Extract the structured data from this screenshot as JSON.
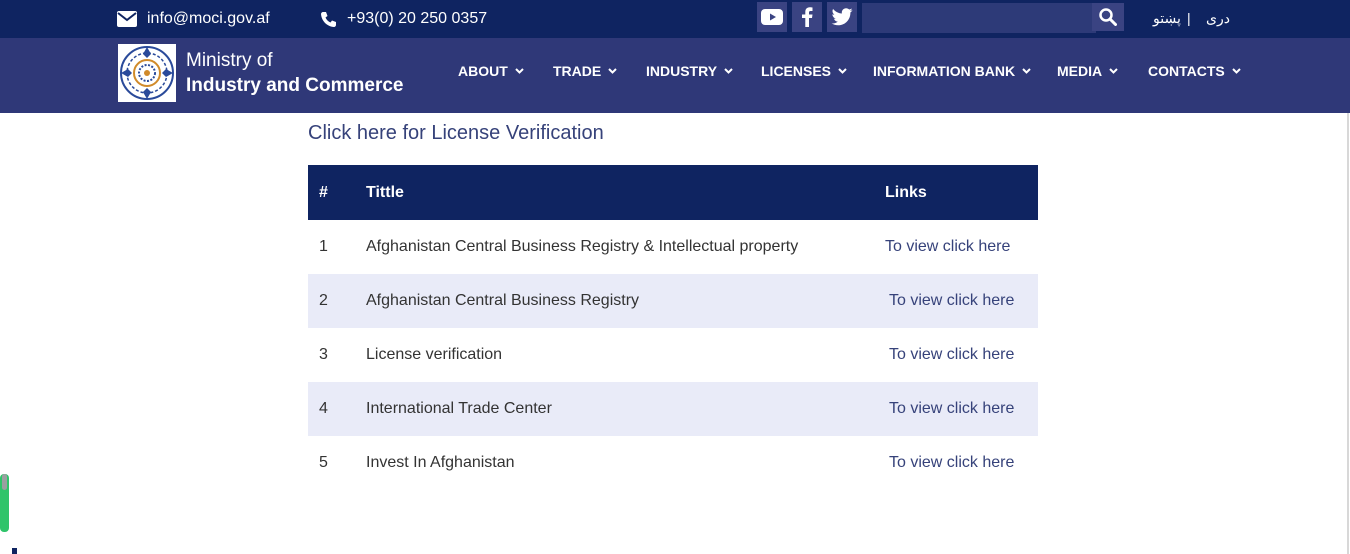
{
  "topbar": {
    "email": "info@moci.gov.af",
    "phone": "+93(0) 20 250 0357",
    "social": [
      "youtube-icon",
      "facebook-icon",
      "twitter-icon"
    ],
    "search_placeholder": "",
    "lang_pashto": "پښتو",
    "lang_sep": "|",
    "lang_dari": "دری"
  },
  "brand": {
    "line1": "Ministry of",
    "line2": "Industry and Commerce"
  },
  "nav": {
    "items": [
      "ABOUT",
      "TRADE",
      "INDUSTRY",
      "LICENSES",
      "INFORMATION BANK",
      "MEDIA",
      "CONTACTS"
    ]
  },
  "main": {
    "verify_link": "Click here for License Verification",
    "table": {
      "headers": [
        "#",
        "Tittle",
        "Links"
      ],
      "rows": [
        {
          "num": "1",
          "title": "Afghanistan Central Business Registry & Intellectual property",
          "link": "To view click here"
        },
        {
          "num": "2",
          "title": "Afghanistan Central Business Registry",
          "link": "To view click here"
        },
        {
          "num": "3",
          "title": "License verification",
          "link": "To view click here"
        },
        {
          "num": "4",
          "title": "International Trade Center",
          "link": "To view click here"
        },
        {
          "num": "5",
          "title": "Invest In Afghanistan",
          "link": "To view click here"
        }
      ]
    }
  },
  "colors": {
    "topbar": "#0f2461",
    "navbar": "#2f3878",
    "accent": "#36427a",
    "row_alt": "#e9ebf8"
  }
}
